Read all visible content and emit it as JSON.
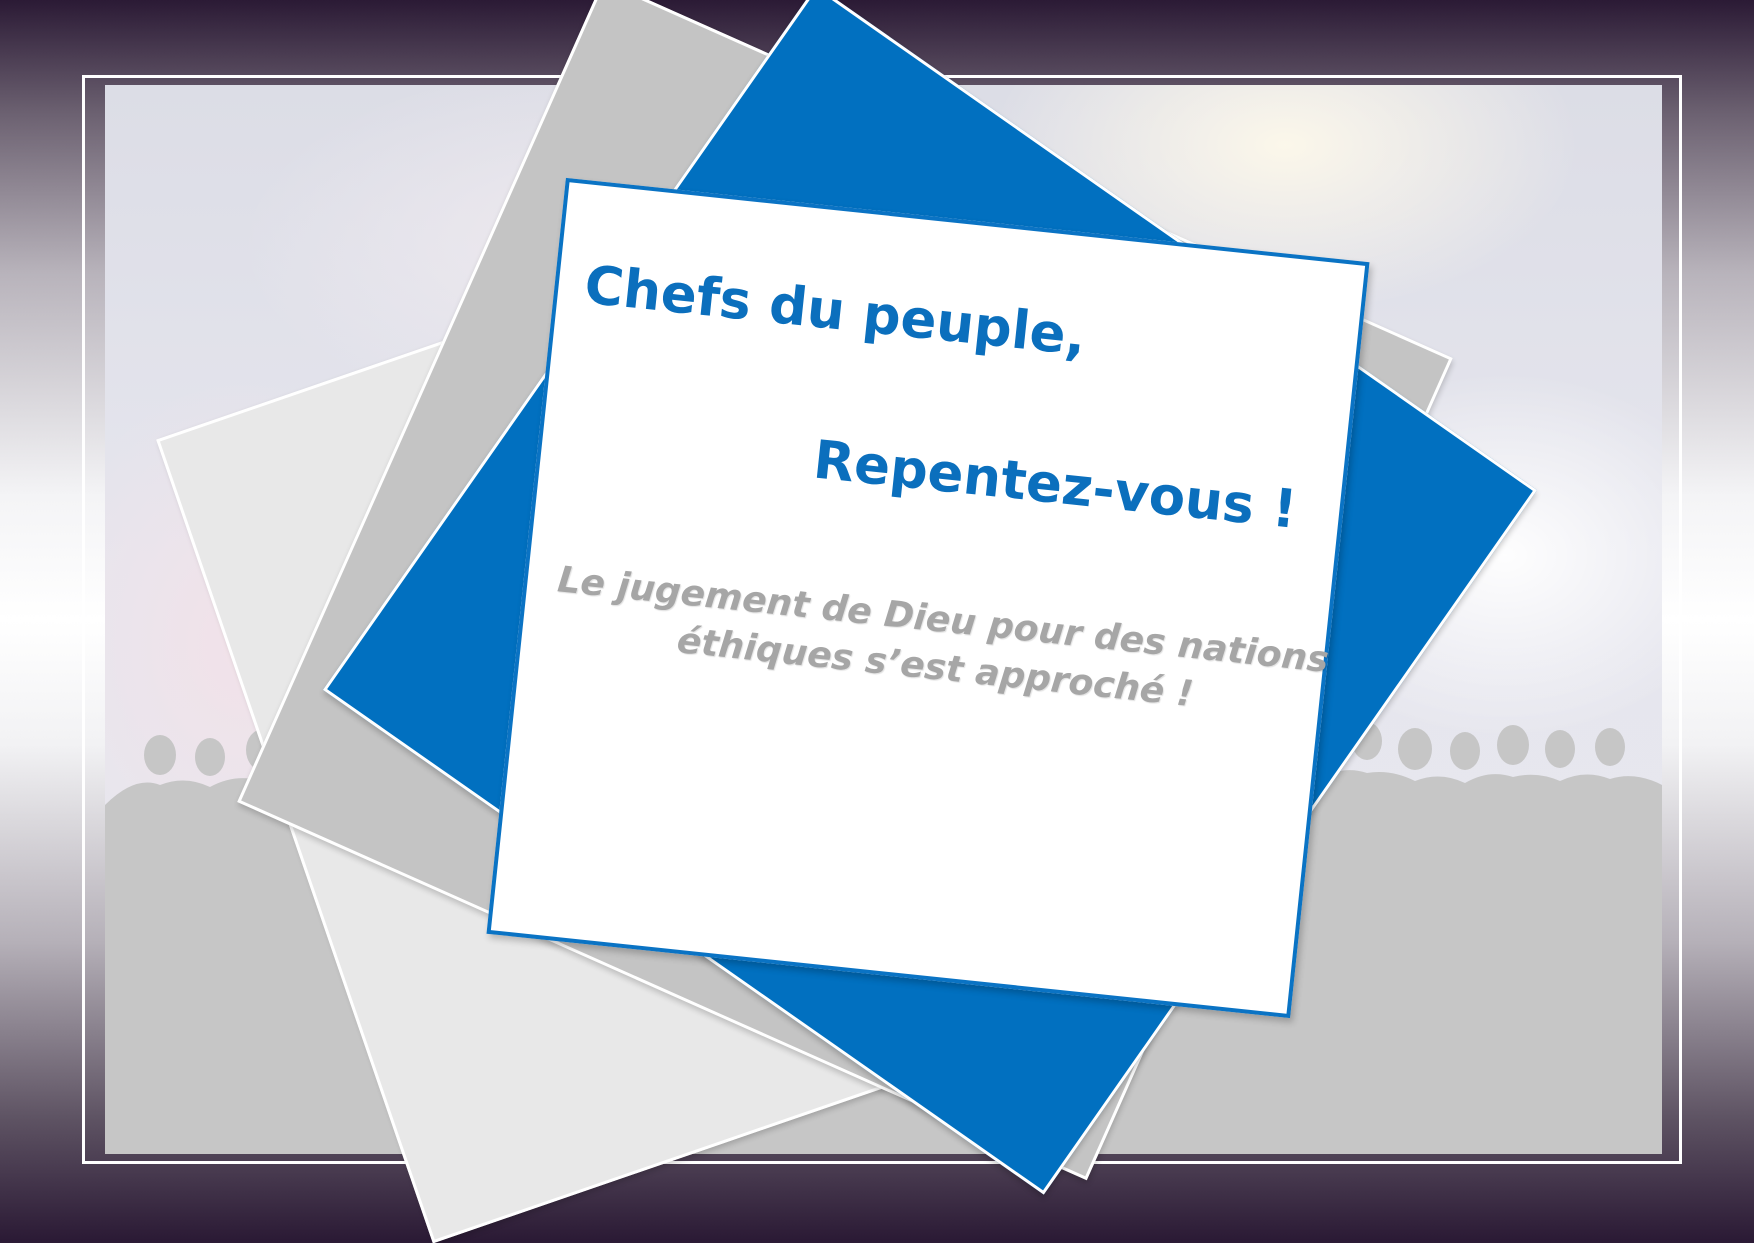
{
  "slide": {
    "title": {
      "line1": "Chefs du peuple,",
      "line2": "Repentez-vous !"
    },
    "subtitle": {
      "line1": "Le jugement de Dieu pour des nations",
      "line2": "éthiques s’est approché !"
    }
  },
  "colors": {
    "outer_frame_dark": "#2b1a35",
    "card_border": "#0a73c4",
    "title_text": "#0b6fbd",
    "subtitle_text": "#a6a6a6",
    "blue_square": "#0170c0",
    "grey_square": "#c4c4c4",
    "light_square": "#e8e8e8",
    "crowd_silhouette": "#c6c6c6"
  }
}
